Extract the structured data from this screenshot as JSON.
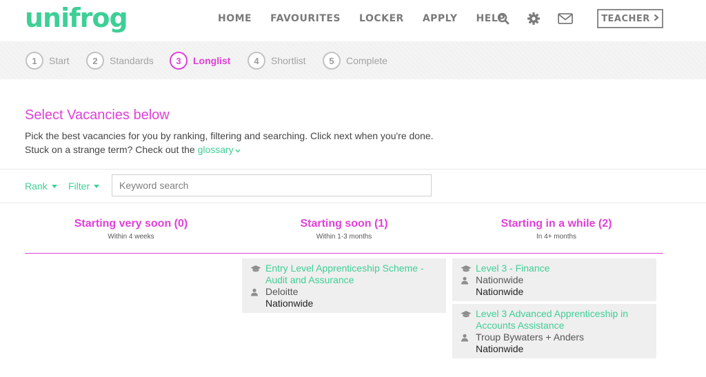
{
  "header": {
    "logo": "unifrog",
    "nav": [
      "HOME",
      "FAVOURITES",
      "LOCKER",
      "APPLY",
      "HELP"
    ],
    "icons": [
      "search-icon",
      "gear-icon",
      "mail-icon"
    ],
    "teacher_label": "TEACHER"
  },
  "steps": [
    {
      "num": "1",
      "label": "Start"
    },
    {
      "num": "2",
      "label": "Standards"
    },
    {
      "num": "3",
      "label": "Longlist"
    },
    {
      "num": "4",
      "label": "Shortlist"
    },
    {
      "num": "5",
      "label": "Complete"
    }
  ],
  "active_step": "Longlist",
  "intro": {
    "title": "Select Vacancies below",
    "line1": "Pick the best vacancies for you by ranking, filtering and searching. Click next when you're done.",
    "line2_prefix": "Stuck on a strange term? Check out the ",
    "glossary": "glossary"
  },
  "toolbar": {
    "rank": "Rank",
    "filter": "Filter",
    "search_placeholder": "Keyword search"
  },
  "columns": [
    {
      "heading": "Starting very soon (0)",
      "sub": "Within 4 weeks",
      "cards": []
    },
    {
      "heading": "Starting soon (1)",
      "sub": "Within 1-3 months",
      "cards": [
        {
          "title": "Entry Level Apprenticeship Scheme - Audit and Assurance",
          "employer": "Deloitte",
          "location": "Nationwide"
        }
      ]
    },
    {
      "heading": "Starting in a while (2)",
      "sub": "In 4+ months",
      "cards": [
        {
          "title": "Level 3 - Finance",
          "employer": "Nationwide",
          "location": "Nationwide"
        },
        {
          "title": "Level 3 Advanced Apprenticeship in Accounts Assistance",
          "employer": "Troup Bywaters + Anders",
          "location": "Nationwide"
        }
      ]
    }
  ],
  "colors": {
    "brand_green": "#3ecf96",
    "accent_magenta": "#e040d8",
    "card_bg": "#efefef"
  }
}
